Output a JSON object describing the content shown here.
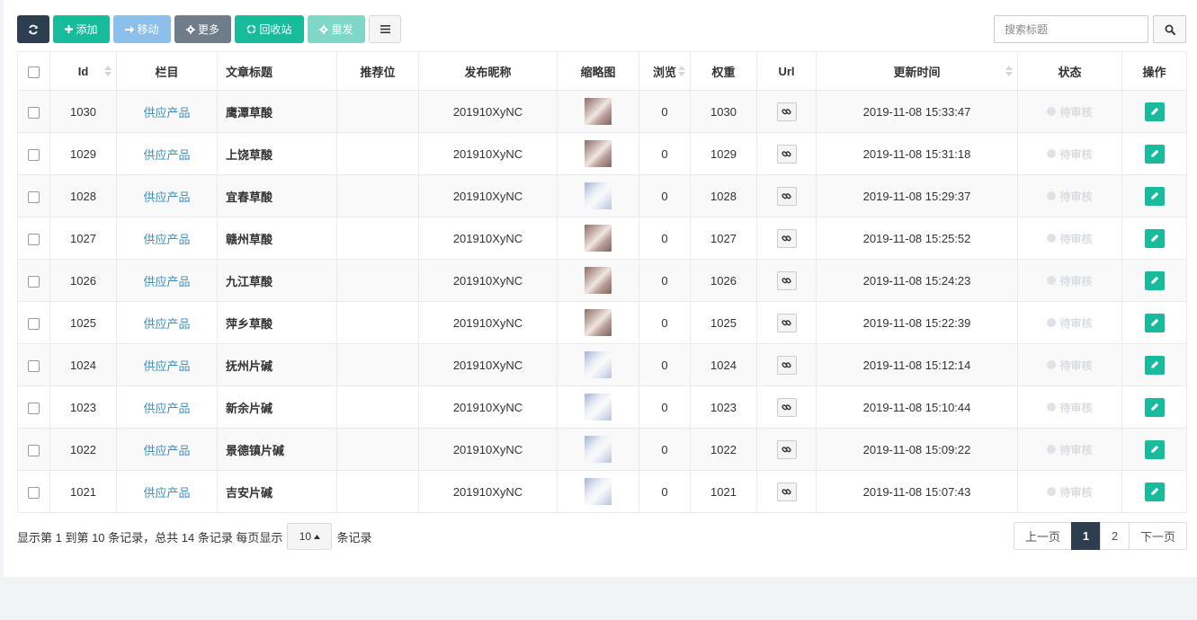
{
  "toolbar": {
    "add_label": "添加",
    "move_label": "移动",
    "more_label": "更多",
    "recycle_label": "回收站",
    "resend_label": "重发"
  },
  "search": {
    "placeholder": "搜索标题"
  },
  "colors": {
    "primary": "#18bc9c",
    "dark": "#2c3e50",
    "link": "#3e8fc0"
  },
  "table": {
    "headers": {
      "id": "Id",
      "category": "栏目",
      "title": "文章标题",
      "recommend": "推荐位",
      "author": "发布昵称",
      "thumb": "缩略图",
      "views": "浏览",
      "weight": "权重",
      "url": "Url",
      "updated": "更新时间",
      "status": "状态",
      "actions": "操作"
    },
    "rows": [
      {
        "id": "1030",
        "category": "供应产品",
        "title": "鹰潭草酸",
        "recommend": "",
        "author": "201910XyNC",
        "thumb": "a",
        "views": "0",
        "weight": "1030",
        "updated": "2019-11-08 15:33:47",
        "status": "待审核"
      },
      {
        "id": "1029",
        "category": "供应产品",
        "title": "上饶草酸",
        "recommend": "",
        "author": "201910XyNC",
        "thumb": "a",
        "views": "0",
        "weight": "1029",
        "updated": "2019-11-08 15:31:18",
        "status": "待审核"
      },
      {
        "id": "1028",
        "category": "供应产品",
        "title": "宜春草酸",
        "recommend": "",
        "author": "201910XyNC",
        "thumb": "b",
        "views": "0",
        "weight": "1028",
        "updated": "2019-11-08 15:29:37",
        "status": "待审核"
      },
      {
        "id": "1027",
        "category": "供应产品",
        "title": "赣州草酸",
        "recommend": "",
        "author": "201910XyNC",
        "thumb": "a",
        "views": "0",
        "weight": "1027",
        "updated": "2019-11-08 15:25:52",
        "status": "待审核"
      },
      {
        "id": "1026",
        "category": "供应产品",
        "title": "九江草酸",
        "recommend": "",
        "author": "201910XyNC",
        "thumb": "a",
        "views": "0",
        "weight": "1026",
        "updated": "2019-11-08 15:24:23",
        "status": "待审核"
      },
      {
        "id": "1025",
        "category": "供应产品",
        "title": "萍乡草酸",
        "recommend": "",
        "author": "201910XyNC",
        "thumb": "a",
        "views": "0",
        "weight": "1025",
        "updated": "2019-11-08 15:22:39",
        "status": "待审核"
      },
      {
        "id": "1024",
        "category": "供应产品",
        "title": "抚州片碱",
        "recommend": "",
        "author": "201910XyNC",
        "thumb": "b",
        "views": "0",
        "weight": "1024",
        "updated": "2019-11-08 15:12:14",
        "status": "待审核"
      },
      {
        "id": "1023",
        "category": "供应产品",
        "title": "新余片碱",
        "recommend": "",
        "author": "201910XyNC",
        "thumb": "b",
        "views": "0",
        "weight": "1023",
        "updated": "2019-11-08 15:10:44",
        "status": "待审核"
      },
      {
        "id": "1022",
        "category": "供应产品",
        "title": "景德镇片碱",
        "recommend": "",
        "author": "201910XyNC",
        "thumb": "b",
        "views": "0",
        "weight": "1022",
        "updated": "2019-11-08 15:09:22",
        "status": "待审核"
      },
      {
        "id": "1021",
        "category": "供应产品",
        "title": "吉安片碱",
        "recommend": "",
        "author": "201910XyNC",
        "thumb": "b",
        "views": "0",
        "weight": "1021",
        "updated": "2019-11-08 15:07:43",
        "status": "待审核"
      }
    ]
  },
  "footer": {
    "info_text": "显示第 1 到第 10 条记录，总共 14 条记录 每页显示",
    "page_size": "10",
    "suffix": "条记录"
  },
  "pagination": {
    "prev": "上一页",
    "pages": [
      "1",
      "2"
    ],
    "active_page": "1",
    "next": "下一页"
  }
}
